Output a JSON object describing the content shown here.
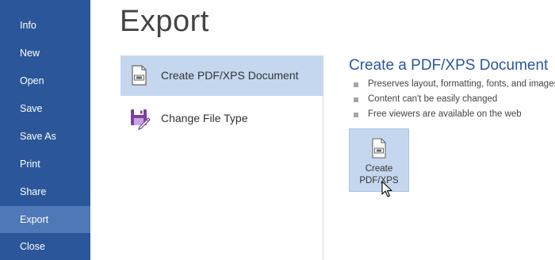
{
  "nav": {
    "items": [
      {
        "label": "Info"
      },
      {
        "label": "New"
      },
      {
        "label": "Open"
      },
      {
        "label": "Save"
      },
      {
        "label": "Save As"
      },
      {
        "label": "Print"
      },
      {
        "label": "Share"
      },
      {
        "label": "Export",
        "active": true
      },
      {
        "label": "Close"
      }
    ]
  },
  "page_title": "Export",
  "options": [
    {
      "label": "Create PDF/XPS Document",
      "icon": "pdf-document-icon",
      "selected": true
    },
    {
      "label": "Change File Type",
      "icon": "change-file-type-icon",
      "selected": false
    }
  ],
  "detail": {
    "title": "Create a PDF/XPS Document",
    "bullets": [
      "Preserves layout, formatting, fonts, and images",
      "Content can't be easily changed",
      "Free viewers are available on the web"
    ],
    "button": {
      "line1": "Create",
      "line2": "PDF/XPS",
      "icon": "pdf-document-icon"
    }
  },
  "colors": {
    "nav_bg": "#2b579a",
    "nav_active": "#4f78b6",
    "selected_bg": "#c5d7ef",
    "accent": "#2b579a",
    "purple_icon": "#7b3f9e"
  }
}
